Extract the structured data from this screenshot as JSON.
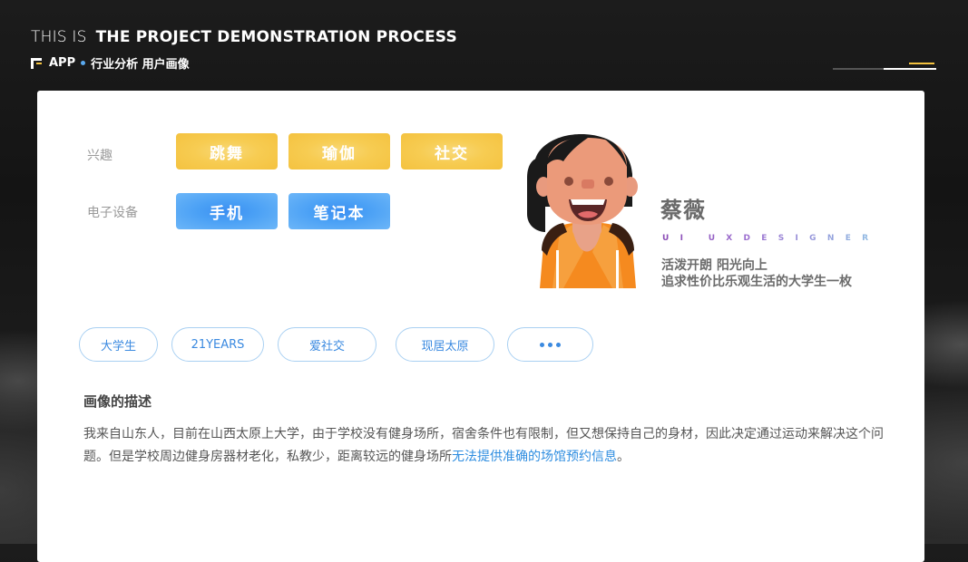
{
  "header": {
    "title_light": "THIS IS",
    "title_bold": "THE PROJECT DEMONSTRATION PROCESS",
    "app_label": "APP",
    "breadcrumb": "行业分析 用户画像"
  },
  "colors": {
    "accent_yellow": "#F4C23F",
    "accent_blue": "#4AA0F5",
    "link_blue": "#2E8DE0",
    "dark_bg": "#1A1A1A"
  },
  "interests": {
    "label": "兴趣",
    "tags": [
      "跳舞",
      "瑜伽",
      "社交"
    ]
  },
  "devices": {
    "label": "电子设备",
    "tags": [
      "手机",
      "笔记本"
    ]
  },
  "profile": {
    "name": "蔡薇",
    "role": "UI UXDESIGNER",
    "desc_line1": "活泼开朗   阳光向上",
    "desc_line2": "追求性价比乐观生活的大学生一枚"
  },
  "pills": [
    "大学生",
    "21YEARS",
    "爱社交",
    "现居太原"
  ],
  "more_icon": "ellipsis-icon",
  "description": {
    "title": "画像的描述",
    "text_main": "我来自山东人，目前在山西太原上大学，由于学校没有健身场所，宿舍条件也有限制，但又想保持自己的身材，因此决定通过运动来解决这个问题。但是学校周边健身房器材老化，私教少，距离较远的健身场所",
    "text_highlight": "无法提供准确的场馆预约信息",
    "text_end": "。"
  }
}
